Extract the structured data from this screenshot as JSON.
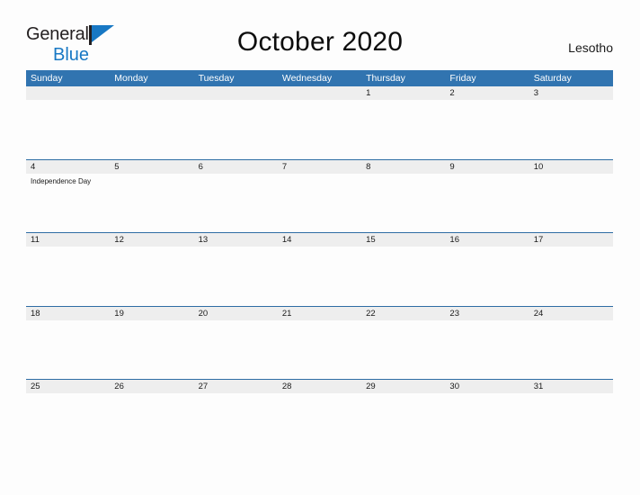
{
  "brand": {
    "name_part1": "General",
    "name_part2": "Blue",
    "flag_icon": "flag-icon",
    "accent_color": "#1878c4"
  },
  "header": {
    "title": "October 2020",
    "region": "Lesotho"
  },
  "calendar": {
    "header_bg_color": "#3174b0",
    "daynum_bg_color": "#eeeeee",
    "row_border_color": "#2e6da4",
    "weekdays": [
      "Sunday",
      "Monday",
      "Tuesday",
      "Wednesday",
      "Thursday",
      "Friday",
      "Saturday"
    ],
    "weeks": [
      {
        "days": [
          {
            "num": "",
            "event": ""
          },
          {
            "num": "",
            "event": ""
          },
          {
            "num": "",
            "event": ""
          },
          {
            "num": "",
            "event": ""
          },
          {
            "num": "1",
            "event": ""
          },
          {
            "num": "2",
            "event": ""
          },
          {
            "num": "3",
            "event": ""
          }
        ]
      },
      {
        "days": [
          {
            "num": "4",
            "event": "Independence Day"
          },
          {
            "num": "5",
            "event": ""
          },
          {
            "num": "6",
            "event": ""
          },
          {
            "num": "7",
            "event": ""
          },
          {
            "num": "8",
            "event": ""
          },
          {
            "num": "9",
            "event": ""
          },
          {
            "num": "10",
            "event": ""
          }
        ]
      },
      {
        "days": [
          {
            "num": "11",
            "event": ""
          },
          {
            "num": "12",
            "event": ""
          },
          {
            "num": "13",
            "event": ""
          },
          {
            "num": "14",
            "event": ""
          },
          {
            "num": "15",
            "event": ""
          },
          {
            "num": "16",
            "event": ""
          },
          {
            "num": "17",
            "event": ""
          }
        ]
      },
      {
        "days": [
          {
            "num": "18",
            "event": ""
          },
          {
            "num": "19",
            "event": ""
          },
          {
            "num": "20",
            "event": ""
          },
          {
            "num": "21",
            "event": ""
          },
          {
            "num": "22",
            "event": ""
          },
          {
            "num": "23",
            "event": ""
          },
          {
            "num": "24",
            "event": ""
          }
        ]
      },
      {
        "days": [
          {
            "num": "25",
            "event": ""
          },
          {
            "num": "26",
            "event": ""
          },
          {
            "num": "27",
            "event": ""
          },
          {
            "num": "28",
            "event": ""
          },
          {
            "num": "29",
            "event": ""
          },
          {
            "num": "30",
            "event": ""
          },
          {
            "num": "31",
            "event": ""
          }
        ]
      }
    ]
  }
}
